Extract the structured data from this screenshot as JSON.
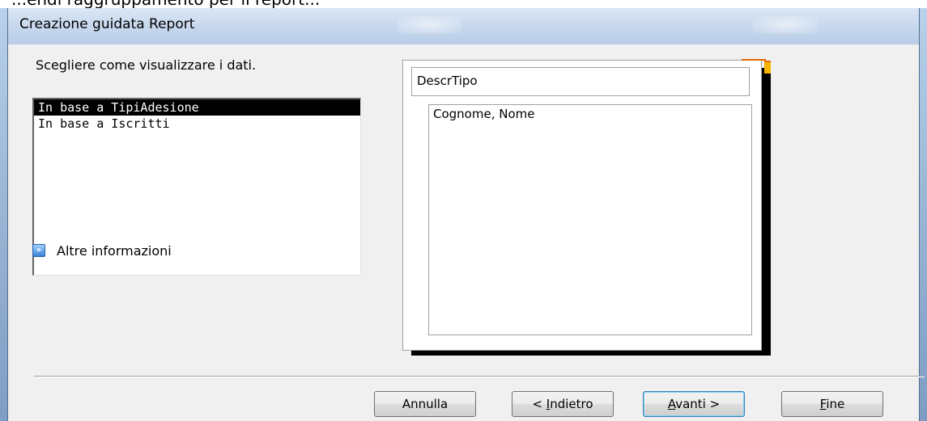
{
  "prev_text_fragment": "...endi raggruppamento per il report...",
  "window": {
    "title": "Creazione guidata Report"
  },
  "prompt": "Scegliere come visualizzare i dati.",
  "view_options": [
    {
      "label": "In base a TipiAdesione",
      "selected": true
    },
    {
      "label": "In base a Iscritti",
      "selected": false
    }
  ],
  "more_info": {
    "label": "Altre informazioni",
    "icon": "double-chevron-icon"
  },
  "preview": {
    "group_field": "DescrTipo",
    "detail_fields": "Cognome, Nome"
  },
  "buttons": {
    "cancel": {
      "text": "Annulla"
    },
    "back": {
      "prefix": "< ",
      "mnemonic": "I",
      "rest": "ndietro"
    },
    "next": {
      "mnemonic": "A",
      "rest": "vanti >"
    },
    "finish": {
      "mnemonic": "F",
      "rest": "ine"
    }
  },
  "colors": {
    "selection_bg": "#000000",
    "dialog_bg": "#f0f0f0",
    "frame": "#9fb9d8",
    "page_corner": "#f4b400"
  }
}
